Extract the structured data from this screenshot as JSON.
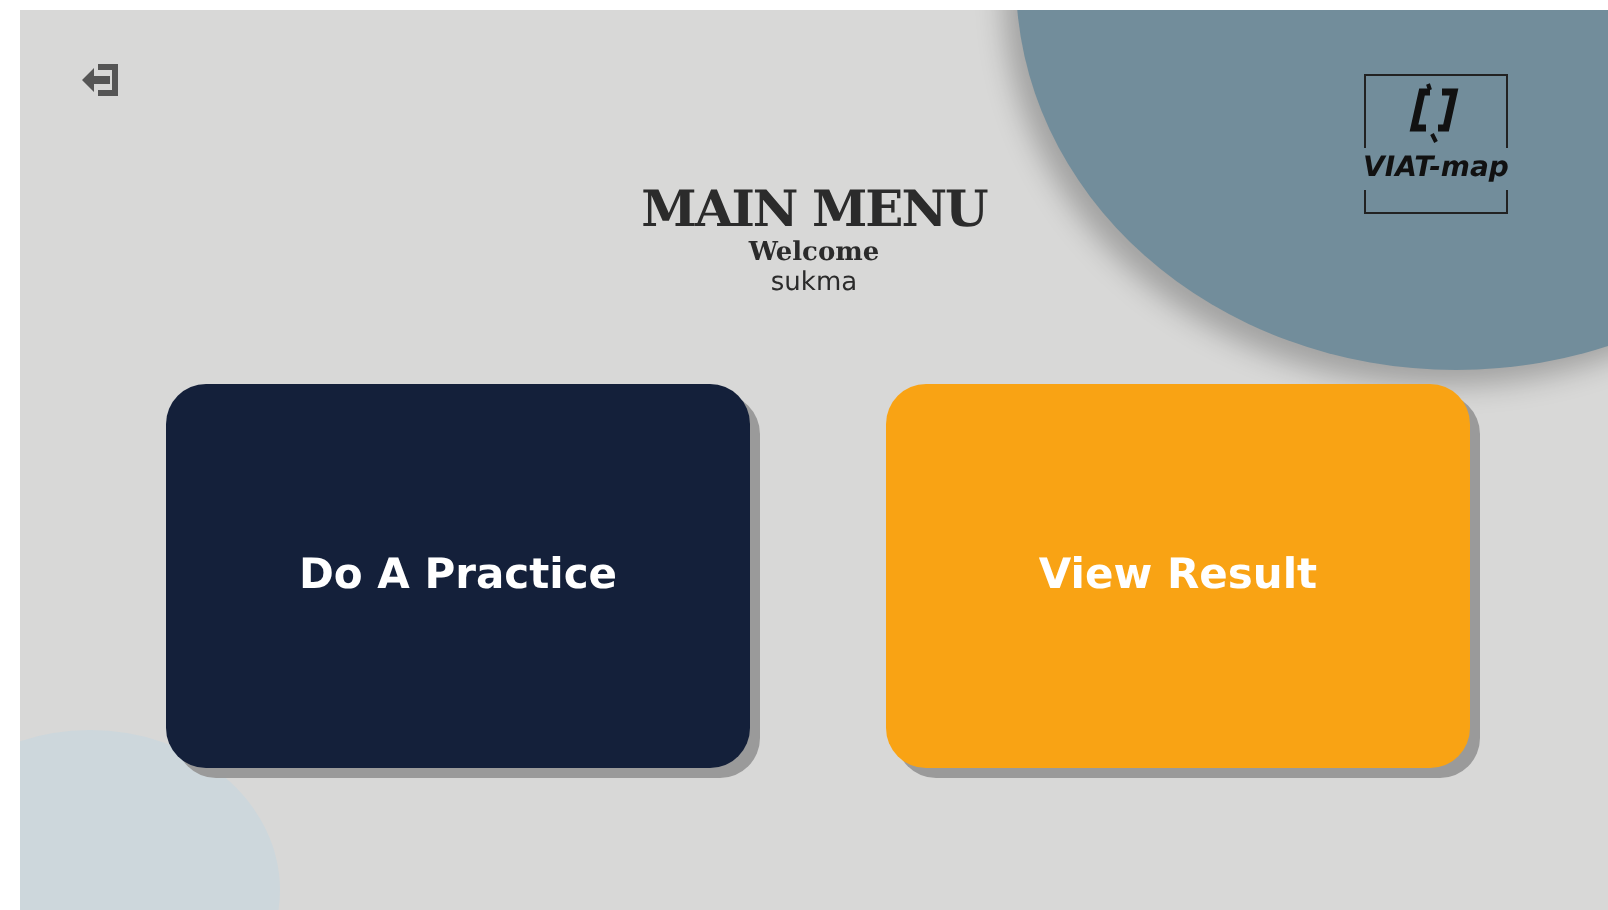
{
  "logo": {
    "text": "VIAT-map"
  },
  "header": {
    "title": "MAIN MENU",
    "greeting": "Welcome",
    "username": "sukma"
  },
  "buttons": [
    {
      "label": "Do A Practice",
      "kind": "dark"
    },
    {
      "label": "View Result",
      "kind": "accent"
    }
  ]
}
